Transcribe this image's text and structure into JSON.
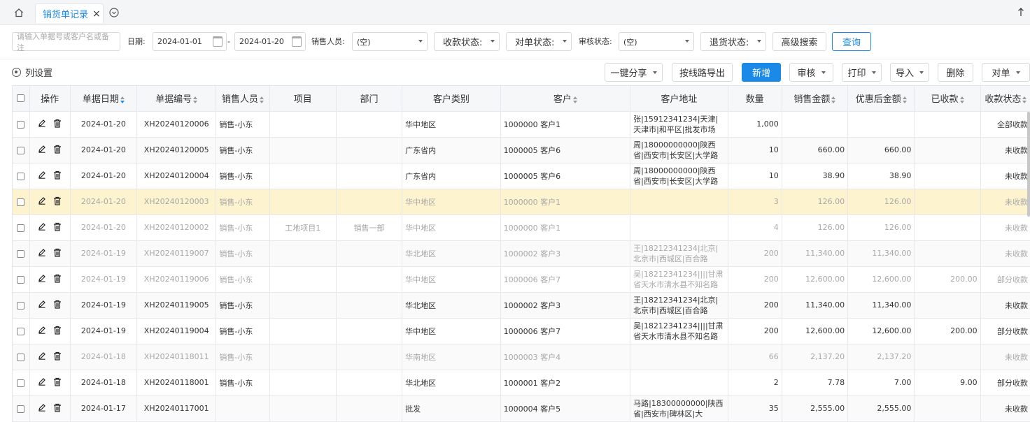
{
  "tabbar": {
    "active_tab": "销货单记录",
    "close_glyph": "×"
  },
  "filters": {
    "search_placeholder": "请输入单据号或客户名或备注",
    "date_label": "日期:",
    "date_from": "2024-01-01",
    "date_sep": "-",
    "date_to": "2024-01-20",
    "salesperson_label": "销售人员:",
    "salesperson_value": "(空)",
    "payment_status": "收款状态:",
    "reconcile_status": "对单状态:",
    "audit_label": "审核状态:",
    "audit_value": "(空)",
    "return_status": "退货状态:",
    "advanced_search": "高级搜索",
    "query": "查询"
  },
  "toolbar": {
    "column_settings": "列设置",
    "share": "一键分享",
    "export_by_route": "按线路导出",
    "add": "新增",
    "audit": "审核",
    "print": "打印",
    "import": "导入",
    "delete": "删除",
    "reconcile": "对单"
  },
  "table": {
    "headers": [
      "操作",
      "单据日期",
      "单据编号",
      "销售人员",
      "项目",
      "部门",
      "客户类别",
      "客户",
      "客户地址",
      "数量",
      "销售金额",
      "优惠后金额",
      "已收款",
      "收款状态"
    ],
    "rows": [
      {
        "date": "2024-01-20",
        "no": "XH20240120006",
        "sales": "销售-小东",
        "project": "",
        "dept": "",
        "cat": "华中地区",
        "cust": "1000000 客户1",
        "addr": "张|15912341234|天津|天津市|和平区|批发市场",
        "qty": "1,000",
        "amt": "",
        "disc": "",
        "paid": "",
        "status": "全部收款",
        "style": "normal"
      },
      {
        "date": "2024-01-20",
        "no": "XH20240120005",
        "sales": "销售-小东",
        "project": "",
        "dept": "",
        "cat": "广东省内",
        "cust": "1000005 客户6",
        "addr": "周|18000000000|陕西省|西安市|长安区|大学路",
        "qty": "10",
        "amt": "660.00",
        "disc": "660.00",
        "paid": "",
        "status": "未收款",
        "style": "alt"
      },
      {
        "date": "2024-01-20",
        "no": "XH20240120004",
        "sales": "销售-小东",
        "project": "",
        "dept": "",
        "cat": "广东省内",
        "cust": "1000005 客户6",
        "addr": "周|18000000000|陕西省|西安市|长安区|大学路",
        "qty": "10",
        "amt": "38.90",
        "disc": "38.90",
        "paid": "",
        "status": "未收款",
        "style": "normal"
      },
      {
        "date": "2024-01-20",
        "no": "XH20240120003",
        "sales": "销售-小东",
        "project": "",
        "dept": "",
        "cat": "华中地区",
        "cust": "1000000 客户1",
        "addr": "",
        "qty": "3",
        "amt": "126.00",
        "disc": "126.00",
        "paid": "",
        "status": "未收款",
        "style": "hl"
      },
      {
        "date": "2024-01-20",
        "no": "XH20240120002",
        "sales": "销售-小东",
        "project": "工地项目1",
        "dept": "销售一部",
        "cat": "华中地区",
        "cust": "1000000 客户1",
        "addr": "",
        "qty": "4",
        "amt": "126.00",
        "disc": "126.00",
        "paid": "",
        "status": "未收款",
        "style": "dim"
      },
      {
        "date": "2024-01-19",
        "no": "XH20240119007",
        "sales": "销售-小东",
        "project": "",
        "dept": "",
        "cat": "华北地区",
        "cust": "1000002 客户3",
        "addr": "王|18212341234|北京|北京市|西城区|百合路",
        "qty": "200",
        "amt": "11,340.00",
        "disc": "11,340.00",
        "paid": "",
        "status": "未收款",
        "style": "dim-alt"
      },
      {
        "date": "2024-01-19",
        "no": "XH20240119006",
        "sales": "销售-小东",
        "project": "",
        "dept": "",
        "cat": "华中地区",
        "cust": "1000006 客户7",
        "addr": "吴|18212341234||||甘肃省天水市清水县不知名路",
        "qty": "200",
        "amt": "12,600.00",
        "disc": "12,600.00",
        "paid": "200.00",
        "status": "部分收款",
        "style": "dim"
      },
      {
        "date": "2024-01-19",
        "no": "XH20240119005",
        "sales": "销售-小东",
        "project": "",
        "dept": "",
        "cat": "华北地区",
        "cust": "1000002 客户3",
        "addr": "王|18212341234|北京|北京市|西城区|百合路",
        "qty": "200",
        "amt": "11,340.00",
        "disc": "11,340.00",
        "paid": "",
        "status": "未收款",
        "style": "alt"
      },
      {
        "date": "2024-01-19",
        "no": "XH20240119004",
        "sales": "销售-小东",
        "project": "",
        "dept": "",
        "cat": "华中地区",
        "cust": "1000006 客户7",
        "addr": "吴|18212341234||||甘肃省天水市清水县不知名路",
        "qty": "200",
        "amt": "12,600.00",
        "disc": "12,600.00",
        "paid": "200.00",
        "status": "部分收款",
        "style": "normal"
      },
      {
        "date": "2024-01-18",
        "no": "XH20240118011",
        "sales": "销售-小东",
        "project": "",
        "dept": "",
        "cat": "华南地区",
        "cust": "1000003 客户4",
        "addr": "",
        "qty": "66",
        "amt": "2,137.20",
        "disc": "2,137.20",
        "paid": "",
        "status": "未收款",
        "style": "dim-alt"
      },
      {
        "date": "2024-01-18",
        "no": "XH20240118001",
        "sales": "销售-小东",
        "project": "",
        "dept": "",
        "cat": "华北地区",
        "cust": "1000001 客户2",
        "addr": "",
        "qty": "2",
        "amt": "7.78",
        "disc": "7.00",
        "paid": "9.00",
        "status": "部分收款",
        "style": "normal"
      },
      {
        "date": "2024-01-17",
        "no": "XH20240117001",
        "sales": "",
        "project": "",
        "dept": "",
        "cat": "批发",
        "cust": "1000004 客户5",
        "addr": "马路|18300000000|陕西省|西安市|碑林区|大",
        "qty": "35",
        "amt": "2,555.00",
        "disc": "2,555.00",
        "paid": "",
        "status": "未收款",
        "style": "alt"
      }
    ]
  },
  "colors": {
    "accent": "#1a89e8",
    "highlight_row": "#fdf3cf"
  }
}
